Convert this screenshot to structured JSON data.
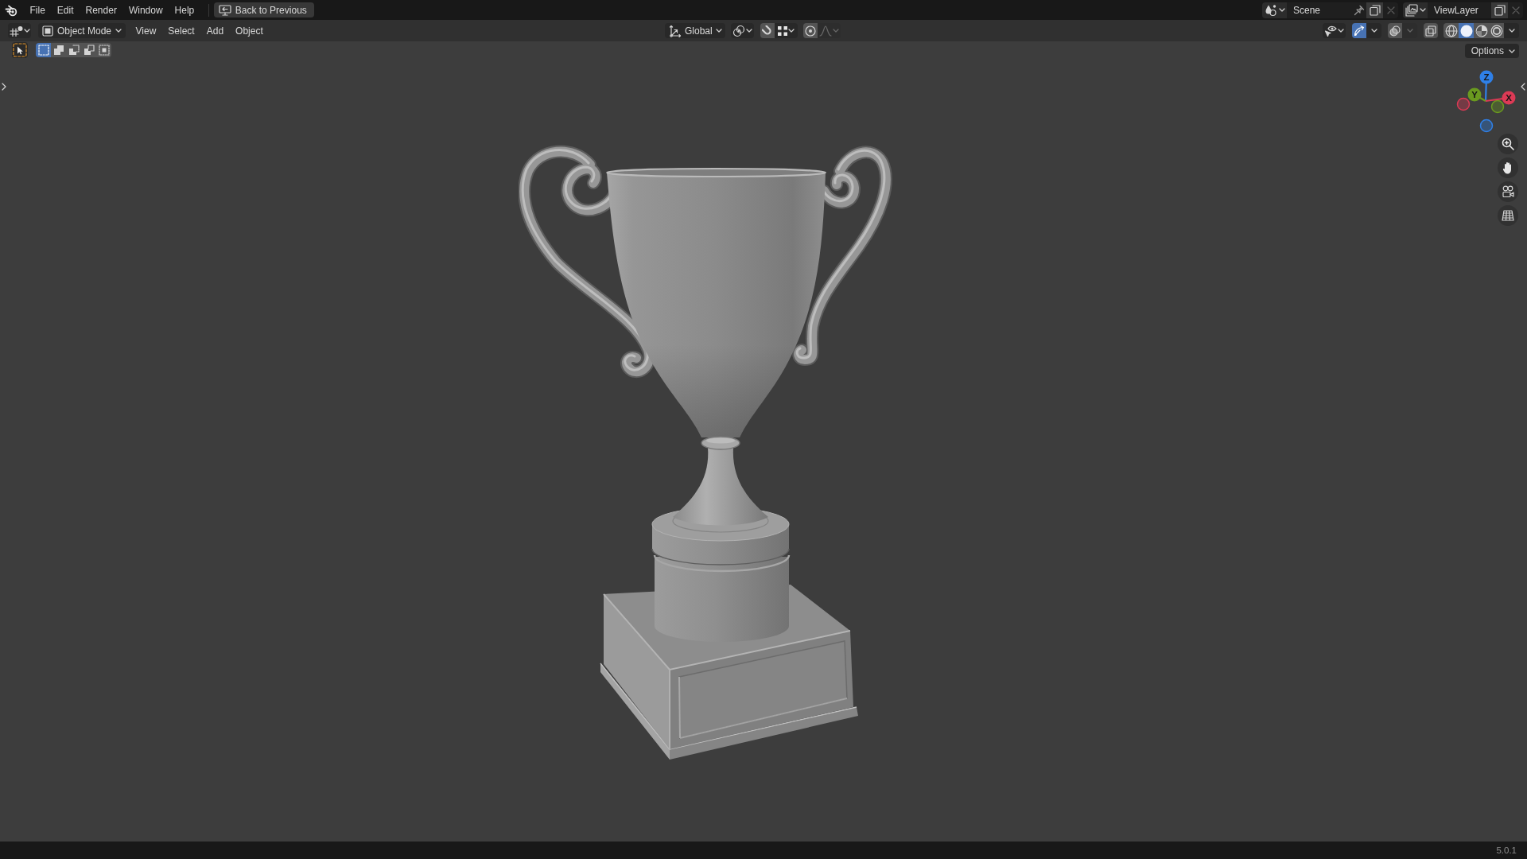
{
  "top_bar": {
    "menus": [
      {
        "label": "File"
      },
      {
        "label": "Edit"
      },
      {
        "label": "Render"
      },
      {
        "label": "Window"
      },
      {
        "label": "Help"
      }
    ],
    "back_button": {
      "label": "Back to Previous"
    },
    "scene_selector": {
      "value": "Scene",
      "unlink_disabled": true
    },
    "view_layer_selector": {
      "value": "ViewLayer",
      "unlink_disabled": true
    }
  },
  "viewport_header": {
    "mode": "Object Mode",
    "menus": [
      {
        "label": "View"
      },
      {
        "label": "Select"
      },
      {
        "label": "Add"
      },
      {
        "label": "Object"
      }
    ],
    "transform_orientation": "Global",
    "snapping": {
      "on": false
    },
    "proportional_editing": {
      "on": false,
      "falloff_disabled": true
    },
    "gizmos": {
      "on": true
    },
    "overlays": {
      "on": false,
      "menu_disabled": true
    },
    "xray": {
      "on": false
    },
    "shading_modes": [
      {
        "kind": "wireframe",
        "selected": false
      },
      {
        "kind": "solid",
        "selected": true
      },
      {
        "kind": "material",
        "selected": false
      },
      {
        "kind": "rendered",
        "selected": false
      }
    ]
  },
  "tool_settings": {
    "select_modes": [
      {
        "kind": "set",
        "selected": true
      },
      {
        "kind": "extend",
        "selected": false
      },
      {
        "kind": "subtract",
        "selected": false
      },
      {
        "kind": "invert",
        "selected": false
      },
      {
        "kind": "intersect",
        "selected": false
      }
    ],
    "options_button": {
      "label": "Options"
    }
  },
  "navigation_gizmo": {
    "axes": [
      {
        "label": "Z",
        "color": "#2f80e8"
      },
      {
        "label": "Y",
        "color": "#6a9a1f"
      },
      {
        "label": "X",
        "color": "#dd3a55"
      }
    ]
  },
  "status_bar": {
    "version": "5.0.1"
  }
}
